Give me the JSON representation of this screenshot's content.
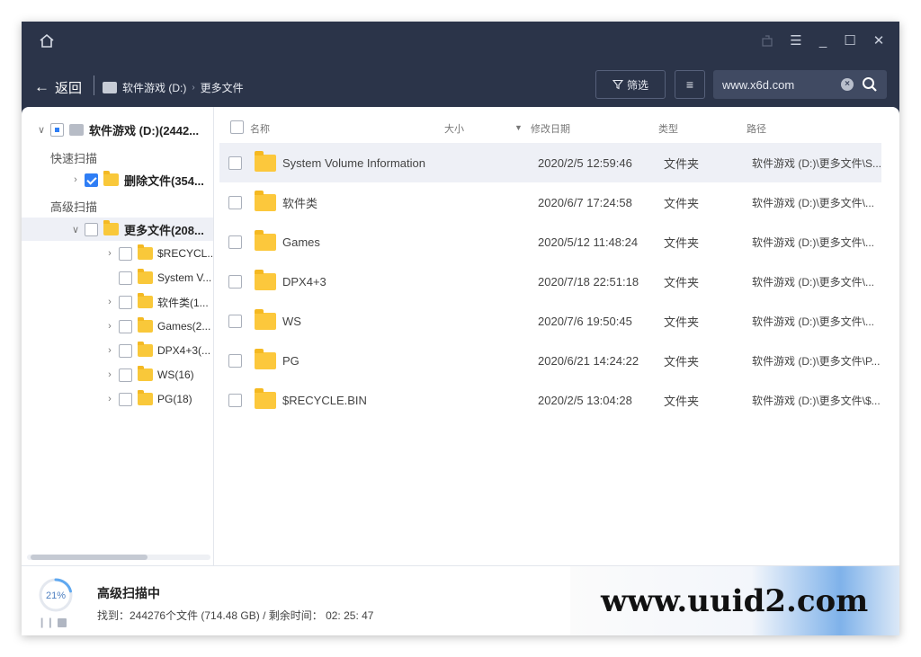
{
  "window": {
    "controls": [
      "restore-icon",
      "menu-icon",
      "minimize-icon",
      "maximize-icon",
      "close-icon"
    ]
  },
  "nav": {
    "back_label": "返回",
    "breadcrumb": {
      "drive": "软件游戏 (D:)",
      "folder": "更多文件"
    },
    "filter_label": "筛选",
    "search": {
      "value": "www.x6d.com"
    }
  },
  "sidebar": {
    "root": "软件游戏 (D:)(2442...",
    "quick_scan_label": "快速扫描",
    "deleted_files": "删除文件(354...",
    "advanced_scan_label": "高级扫描",
    "more_files": "更多文件(208...",
    "children": [
      "$RECYCL...",
      "System V...",
      "软件类(1...",
      "Games(2...",
      "DPX4+3(...",
      "WS(16)",
      "PG(18)"
    ]
  },
  "table": {
    "headers": {
      "name": "名称",
      "size": "大小",
      "modified": "修改日期",
      "type": "类型",
      "path": "路径"
    },
    "rows": [
      {
        "name": "System Volume Information",
        "modified": "2020/2/5 12:59:46",
        "type": "文件夹",
        "path": "软件游戏 (D:)\\更多文件\\S..."
      },
      {
        "name": "软件类",
        "modified": "2020/6/7 17:24:58",
        "type": "文件夹",
        "path": "软件游戏 (D:)\\更多文件\\..."
      },
      {
        "name": "Games",
        "modified": "2020/5/12 11:48:24",
        "type": "文件夹",
        "path": "软件游戏 (D:)\\更多文件\\..."
      },
      {
        "name": "DPX4+3",
        "modified": "2020/7/18 22:51:18",
        "type": "文件夹",
        "path": "软件游戏 (D:)\\更多文件\\..."
      },
      {
        "name": "WS",
        "modified": "2020/7/6 19:50:45",
        "type": "文件夹",
        "path": "软件游戏 (D:)\\更多文件\\..."
      },
      {
        "name": "PG",
        "modified": "2020/6/21 14:24:22",
        "type": "文件夹",
        "path": "软件游戏 (D:)\\更多文件\\P..."
      },
      {
        "name": "$RECYCLE.BIN",
        "modified": "2020/2/5 13:04:28",
        "type": "文件夹",
        "path": "软件游戏 (D:)\\更多文件\\$..."
      }
    ]
  },
  "status": {
    "percent_label": "21%",
    "progress_fraction": 0.21,
    "title": "高级扫描中",
    "details": "找到：244276个文件 (714.48 GB) / 剩余时间：  02: 25: 47"
  },
  "watermark": "www.uuid2.com",
  "colors": {
    "header_bg": "#2b3449",
    "accent": "#2f7ef5",
    "folder": "#fcc83c"
  }
}
